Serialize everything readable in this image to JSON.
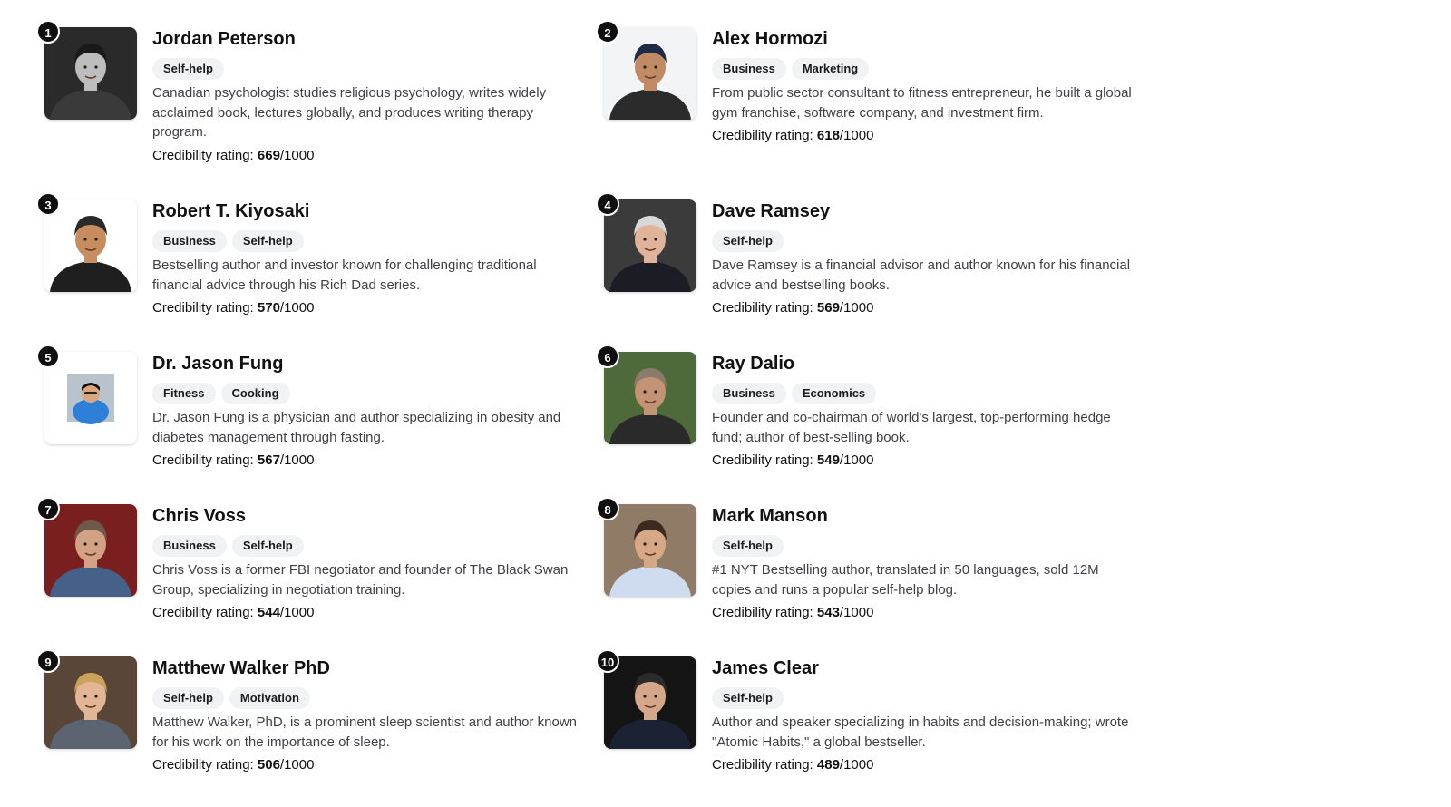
{
  "people": [
    {
      "rank": "1",
      "name": "Jordan Peterson",
      "tags": [
        "Self-help"
      ],
      "description": "Canadian psychologist studies religious psychology, writes widely acclaimed book, lectures globally, and produces writing therapy program.",
      "rating_label": "Credibility rating:",
      "rating_value": "669",
      "rating_max": "/1000",
      "photo": {
        "bg": "#2a2a2a",
        "skin": "#bdbdbd",
        "hair": "#1a1a1a",
        "shirt": "#3a3a3a"
      }
    },
    {
      "rank": "2",
      "name": "Alex Hormozi",
      "tags": [
        "Business",
        "Marketing"
      ],
      "description": "From public sector consultant to fitness entrepreneur, he built a global gym franchise, software company, and investment firm.",
      "rating_label": "Credibility rating:",
      "rating_value": "618",
      "rating_max": "/1000",
      "photo": {
        "bg": "#f3f4f6",
        "skin": "#c08a62",
        "hair": "#1f2a44",
        "shirt": "#2b2b2b"
      }
    },
    {
      "rank": "3",
      "name": "Robert T. Kiyosaki",
      "tags": [
        "Business",
        "Self-help"
      ],
      "description": "Bestselling author and investor known for challenging traditional financial advice through his Rich Dad series.",
      "rating_label": "Credibility rating:",
      "rating_value": "570",
      "rating_max": "/1000",
      "photo": {
        "bg": "#ffffff",
        "skin": "#c78d5e",
        "hair": "#2a2a2a",
        "shirt": "#1e1e1e"
      }
    },
    {
      "rank": "4",
      "name": "Dave Ramsey",
      "tags": [
        "Self-help"
      ],
      "description": "Dave Ramsey is a financial advisor and author known for his financial advice and bestselling books.",
      "rating_label": "Credibility rating:",
      "rating_value": "569",
      "rating_max": "/1000",
      "photo": {
        "bg": "#3b3b3b",
        "skin": "#dfb49a",
        "hair": "#d8d8d8",
        "shirt": "#1c1c24"
      }
    },
    {
      "rank": "5",
      "name": "Dr. Jason Fung",
      "tags": [
        "Fitness",
        "Cooking"
      ],
      "description": "Dr. Jason Fung is a physician and author specializing in obesity and diabetes management through fasting.",
      "rating_label": "Credibility rating:",
      "rating_value": "567",
      "rating_max": "/1000",
      "photo": {
        "bg": "#ffffff",
        "skin": "#d9a77f",
        "hair": "#111111",
        "shirt": "#2f7ed8"
      }
    },
    {
      "rank": "6",
      "name": "Ray Dalio",
      "tags": [
        "Business",
        "Economics"
      ],
      "description": "Founder and co-chairman of world's largest, top-performing hedge fund; author of best-selling book.",
      "rating_label": "Credibility rating:",
      "rating_value": "549",
      "rating_max": "/1000",
      "photo": {
        "bg": "#4e6a3a",
        "skin": "#c49274",
        "hair": "#8a7b6a",
        "shirt": "#2a2a2a"
      }
    },
    {
      "rank": "7",
      "name": "Chris Voss",
      "tags": [
        "Business",
        "Self-help"
      ],
      "description": "Chris Voss is a former FBI negotiator and founder of The Black Swan Group, specializing in negotiation training.",
      "rating_label": "Credibility rating:",
      "rating_value": "544",
      "rating_max": "/1000",
      "photo": {
        "bg": "#7a1f1f",
        "skin": "#d3a184",
        "hair": "#6d5a4a",
        "shirt": "#45618a"
      }
    },
    {
      "rank": "8",
      "name": "Mark Manson",
      "tags": [
        "Self-help"
      ],
      "description": "#1 NYT Bestselling author, translated in 50 languages, sold 12M copies and runs a popular self-help blog.",
      "rating_label": "Credibility rating:",
      "rating_value": "543",
      "rating_max": "/1000",
      "photo": {
        "bg": "#8f7b66",
        "skin": "#d6a886",
        "hair": "#3a2a20",
        "shirt": "#cfdbef"
      }
    },
    {
      "rank": "9",
      "name": "Matthew Walker PhD",
      "tags": [
        "Self-help",
        "Motivation"
      ],
      "description": "Matthew Walker, PhD, is a prominent sleep scientist and author known for his work on the importance of sleep.",
      "rating_label": "Credibility rating:",
      "rating_value": "506",
      "rating_max": "/1000",
      "photo": {
        "bg": "#5a4638",
        "skin": "#e2b596",
        "hair": "#c9a35a",
        "shirt": "#5b6470"
      }
    },
    {
      "rank": "10",
      "name": "James Clear",
      "tags": [
        "Self-help"
      ],
      "description": "Author and speaker specializing in habits and decision-making; wrote \"Atomic Habits,\" a global bestseller.",
      "rating_label": "Credibility rating:",
      "rating_value": "489",
      "rating_max": "/1000",
      "photo": {
        "bg": "#141414",
        "skin": "#d4a68a",
        "hair": "#2b2b2b",
        "shirt": "#1a2233"
      }
    }
  ]
}
